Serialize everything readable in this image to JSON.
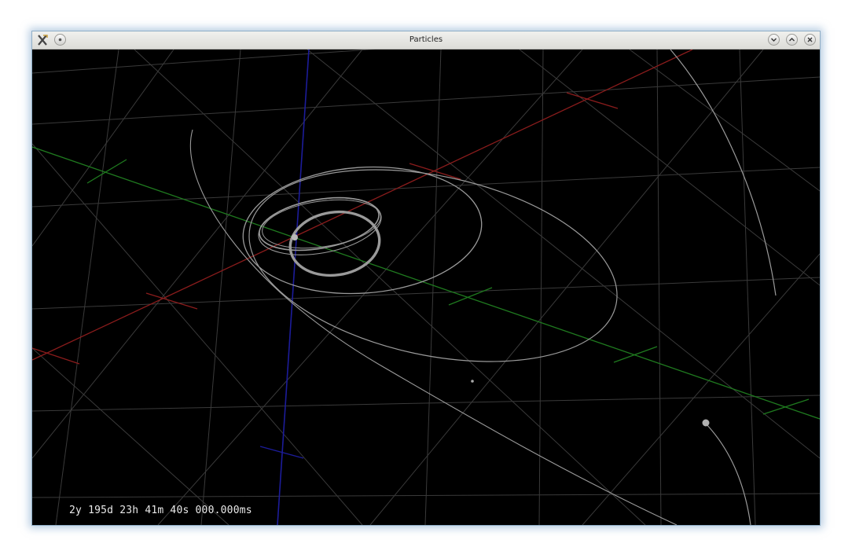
{
  "window": {
    "title": "Particles"
  },
  "icons": {
    "app": "particles-app-icon",
    "menu": "window-menu-icon",
    "minimize": "minimize-icon",
    "maximize": "maximize-icon",
    "close": "close-icon"
  },
  "scene": {
    "background": "#000000",
    "grid_color": "#3a3a3a",
    "axis_x_color": "#8b1c1c",
    "axis_y_color": "#1f7a1f",
    "axis_z_color": "#1c1c9a",
    "orbit_color": "#9a9a9a"
  },
  "status": {
    "time": "2y 195d 23h 41m 40s 000.000ms"
  }
}
